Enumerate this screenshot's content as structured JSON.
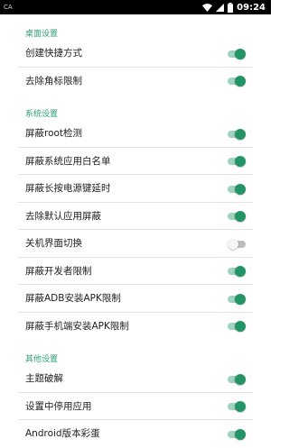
{
  "status_bar": {
    "left_text": "CA",
    "time": "09:24",
    "icons": [
      "wifi-icon",
      "signal-icon",
      "battery-icon"
    ]
  },
  "colors": {
    "accent": "#2e9e74",
    "switch_on_thumb": "#249467",
    "switch_on_track": "#9fd3bd",
    "switch_off_thumb": "#f5f5f5",
    "switch_off_track": "#bdbdbd",
    "status_bar_bg": "#000000"
  },
  "sections": [
    {
      "title": "桌面设置",
      "items": [
        {
          "label": "创建快捷方式",
          "enabled": true
        },
        {
          "label": "去除角标限制",
          "enabled": true
        }
      ]
    },
    {
      "title": "系统设置",
      "items": [
        {
          "label": "屏蔽root检测",
          "enabled": true
        },
        {
          "label": "屏蔽系统应用白名单",
          "enabled": true
        },
        {
          "label": "屏蔽长按电源键延时",
          "enabled": true
        },
        {
          "label": "去除默认应用屏蔽",
          "enabled": true
        },
        {
          "label": "关机界面切换",
          "enabled": false
        },
        {
          "label": "屏蔽开发者限制",
          "enabled": true
        },
        {
          "label": "屏蔽ADB安装APK限制",
          "enabled": true
        },
        {
          "label": "屏蔽手机端安装APK限制",
          "enabled": true
        }
      ]
    },
    {
      "title": "其他设置",
      "items": [
        {
          "label": "主题破解",
          "enabled": true
        },
        {
          "label": "设置中停用应用",
          "enabled": true
        },
        {
          "label": "Android版本彩蛋",
          "enabled": true
        }
      ]
    }
  ]
}
